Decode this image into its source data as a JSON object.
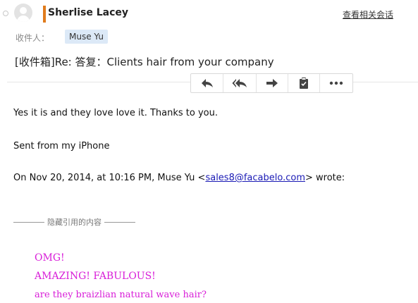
{
  "header": {
    "sender_name": "Sherlise Lacey",
    "related_link": "查看相关会话",
    "to_label": "收件人：",
    "recipient": "Muse Yu",
    "subject": "[收件箱]Re: 答复：Clients hair from your company"
  },
  "toolbar": {
    "buttons": [
      {
        "icon": "reply-icon"
      },
      {
        "icon": "reply-all-icon"
      },
      {
        "icon": "forward-icon"
      },
      {
        "icon": "clipboard-icon"
      },
      {
        "icon": "more-icon"
      }
    ]
  },
  "body": {
    "line1": "Yes it is and they love love it. Thanks to you.",
    "line2": "Sent from my iPhone",
    "line3_prefix": "On Nov 20, 2014, at 10:16 PM, Muse Yu <",
    "line3_email": "sales8@facabelo.com",
    "line3_suffix": "> wrote:",
    "quote_toggle": "隐藏引用的内容",
    "quoted_lines": [
      "OMG!",
      "AMAZING!  FABULOUS!",
      "are they braizlian natural wave hair?"
    ]
  },
  "colors": {
    "sender_accent": "#e07b1c",
    "recipient_chip": "#dce9f7",
    "quoted_text": "#d81dd8",
    "link": "#1a1ab5"
  }
}
